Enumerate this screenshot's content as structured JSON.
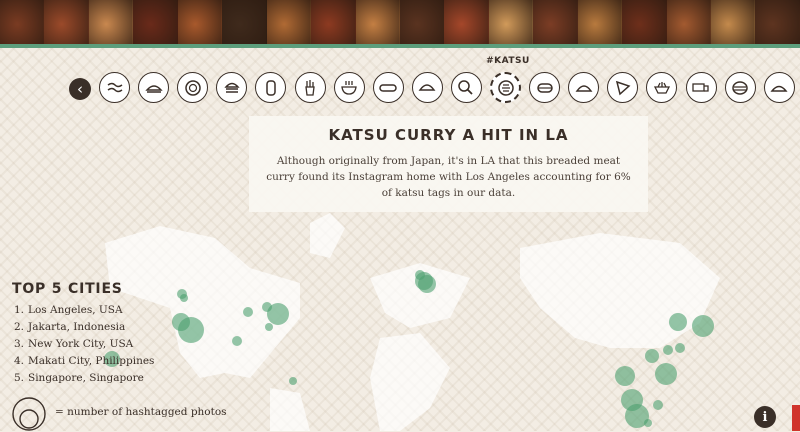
{
  "photo_strip": {
    "colors": [
      "#7a3b22",
      "#9b4a2a",
      "#c9884f",
      "#6a2a1a",
      "#a8592c",
      "#3f2a1c",
      "#b06a34",
      "#8d3a21",
      "#c47f43",
      "#5a3320",
      "#a5472a",
      "#d19a5a",
      "#7c3d25",
      "#b87a3e",
      "#6e2f1b",
      "#a35a30",
      "#c48a4c",
      "#5e3420"
    ]
  },
  "nav": {
    "prev_symbol": "‹"
  },
  "icons": [
    {
      "name": "bacon"
    },
    {
      "name": "sandwich"
    },
    {
      "name": "plate"
    },
    {
      "name": "burger"
    },
    {
      "name": "burrito"
    },
    {
      "name": "fries"
    },
    {
      "name": "ramen"
    },
    {
      "name": "hotdog"
    },
    {
      "name": "empanada"
    },
    {
      "name": "drumstick"
    },
    {
      "name": "katsu"
    },
    {
      "name": "macaron"
    },
    {
      "name": "dumpling"
    },
    {
      "name": "pizza"
    },
    {
      "name": "salad"
    },
    {
      "name": "food-truck"
    },
    {
      "name": "sushi"
    },
    {
      "name": "gyoza"
    }
  ],
  "active_tag": "#KATSU",
  "card": {
    "title": "KATSU CURRY A HIT IN LA",
    "text": "Although originally from Japan, it's in LA that this breaded meat curry found its Instagram home with Los Angeles accounting for 6% of katsu tags in our data."
  },
  "cities": {
    "title": "TOP 5 CITIES",
    "items": [
      {
        "num": "1.",
        "label": "Los Angeles, USA"
      },
      {
        "num": "2.",
        "label": "Jakarta, Indonesia"
      },
      {
        "num": "3.",
        "label": "New York City, USA"
      },
      {
        "num": "4.",
        "label": "Makati City, Philippines"
      },
      {
        "num": "5.",
        "label": "Singapore, Singapore"
      }
    ]
  },
  "legend": {
    "text": "= number of hashtagged photos"
  },
  "info_symbol": "i",
  "colors": {
    "bubble": "#4ca070",
    "accent_green": "#5c9e7c",
    "dark": "#3a2f28",
    "red": "#d0342c"
  }
}
